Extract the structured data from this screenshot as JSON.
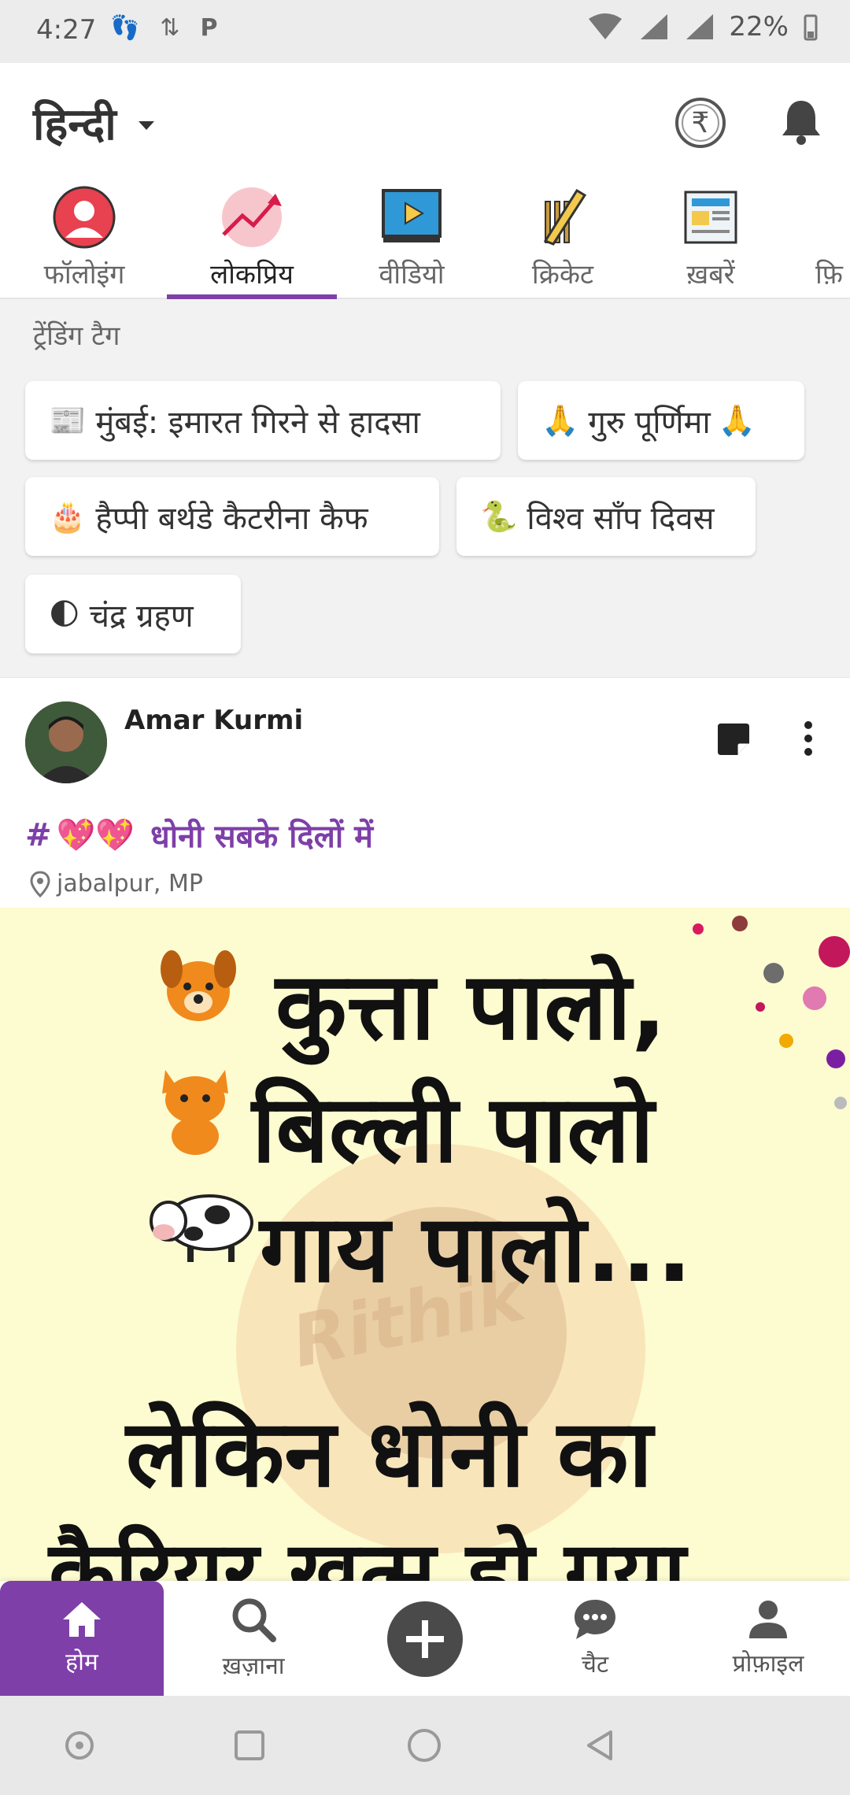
{
  "status_bar": {
    "time": "4:27",
    "battery": "22%"
  },
  "header": {
    "language": "हिन्दी"
  },
  "tabs": [
    {
      "label": "फॉलोइंग"
    },
    {
      "label": "लोकप्रिय"
    },
    {
      "label": "वीडियो"
    },
    {
      "label": "क्रिकेट"
    },
    {
      "label": "ख़बरें"
    },
    {
      "label": "फ़ि"
    }
  ],
  "trending": {
    "title": "ट्रेंडिंग टैग",
    "chips": [
      {
        "emoji": "📰",
        "label": "मुंबई: इमारत गिरने से हादसा"
      },
      {
        "emoji": "🙏",
        "label": "गुरु पूर्णिमा",
        "suffix": "🙏"
      },
      {
        "emoji": "🎂",
        "label": "हैप्पी बर्थडे कैटरीना कैफ"
      },
      {
        "emoji": "🐍",
        "label": "विश्व साँप दिवस"
      },
      {
        "emoji": "🌓",
        "label": "चंद्र ग्रहण"
      }
    ]
  },
  "post": {
    "author": "Amar Kurmi",
    "caption_hash": "#",
    "caption_hearts": "💖💖",
    "caption_text": "धोनी सबके दिलों में",
    "location": "jabalpur, MP",
    "image_lines": [
      "कुत्ता पालो,",
      "बिल्ली पालो",
      "गाय पालो...",
      "लेकिन धोनी का",
      "कैरियर खत्म हो गया"
    ],
    "watermark": "Rithik"
  },
  "bottom_nav": [
    {
      "label": "होम"
    },
    {
      "label": "ख़ज़ाना"
    },
    {
      "label": "चैट"
    },
    {
      "label": "प्रोफ़ाइल"
    }
  ],
  "colors": {
    "accent": "#7e3fa8",
    "image_bg": "#fdfbd0"
  }
}
